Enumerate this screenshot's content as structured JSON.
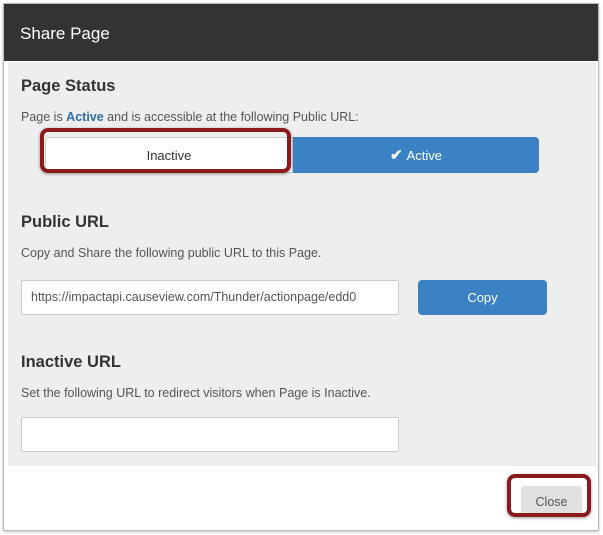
{
  "dialog": {
    "title": "Share Page"
  },
  "page_status": {
    "heading": "Page Status",
    "desc_prefix": "Page is ",
    "desc_status": "Active",
    "desc_suffix": " and is accessible at the following Public URL:",
    "option_inactive": "Inactive",
    "option_active": "Active",
    "selected": "Active",
    "active_icon": "check-icon"
  },
  "public_url": {
    "heading": "Public URL",
    "description": "Copy and Share the following public URL to this Page.",
    "value": "https://impactapi.causeview.com/Thunder/actionpage/edd0",
    "copy_label": "Copy"
  },
  "inactive_url": {
    "heading": "Inactive URL",
    "description": "Set the following URL to redirect visitors when Page is Inactive.",
    "value": ""
  },
  "footer": {
    "close_label": "Close"
  },
  "colors": {
    "header_bg": "#333333",
    "body_bg": "#eeeeee",
    "primary_blue": "#3b82c4",
    "highlight": "#8b1a1f"
  }
}
